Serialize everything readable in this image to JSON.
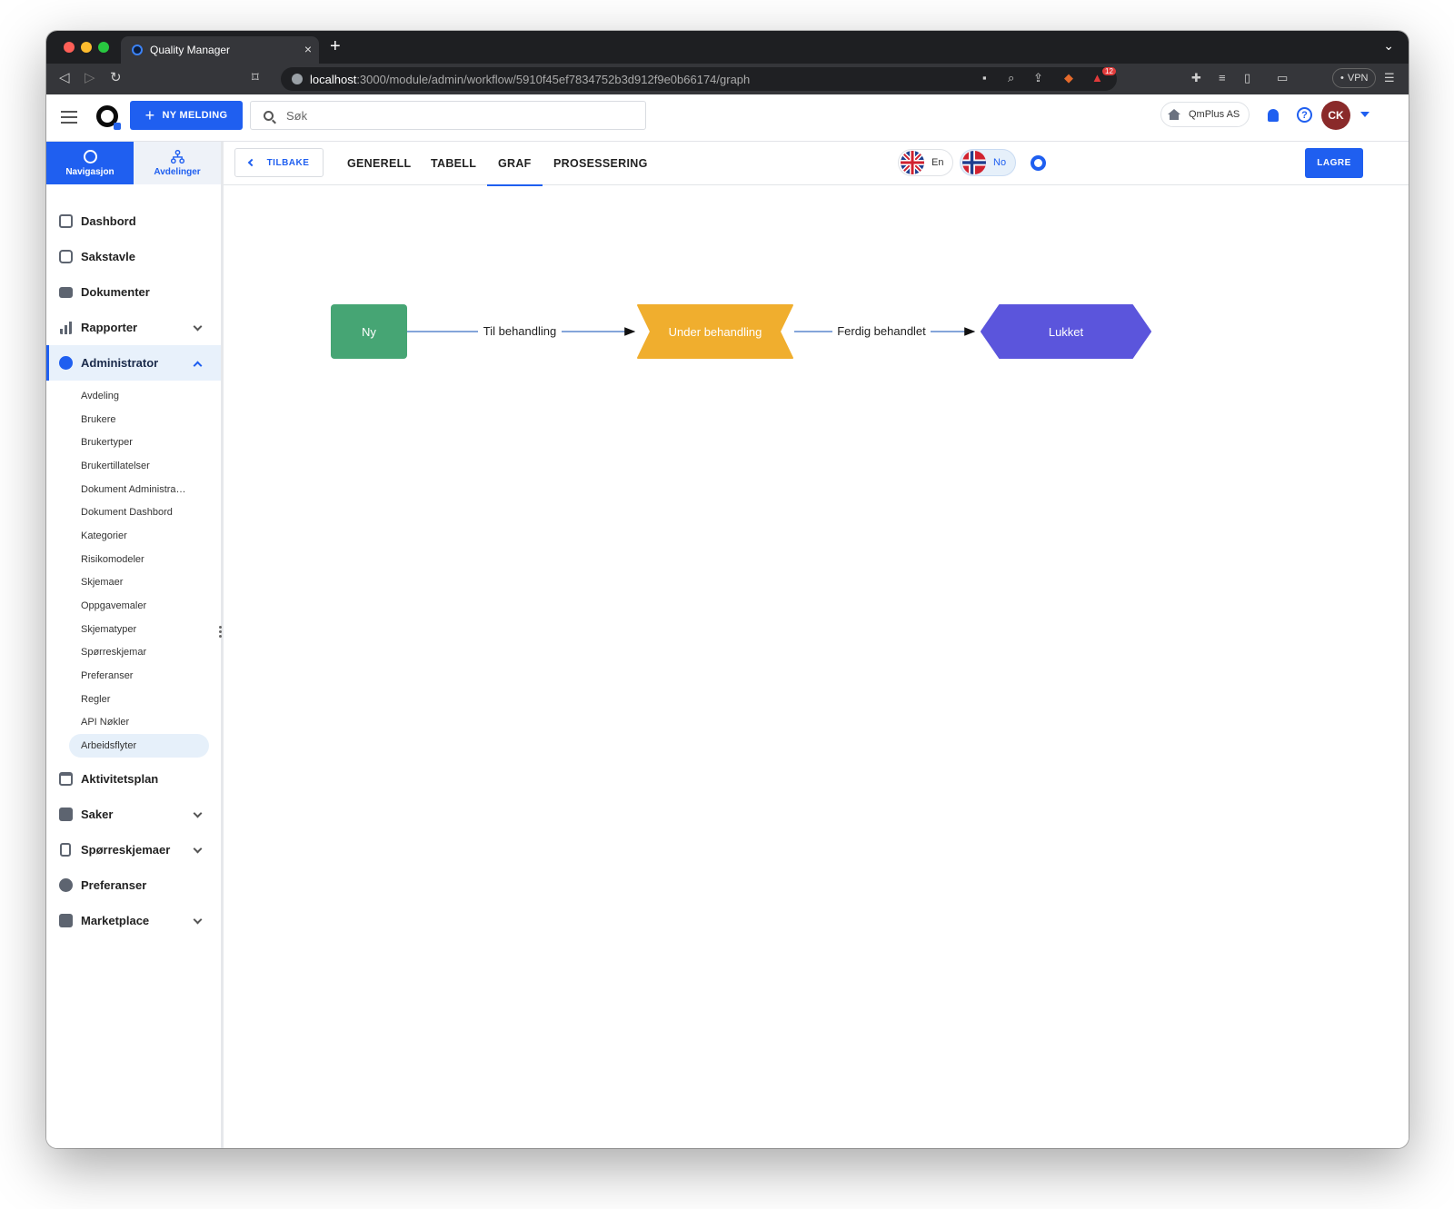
{
  "browser": {
    "tab_title": "Quality Manager",
    "url_host": "localhost",
    "url_rest": ":3000/module/admin/workflow/5910f45ef7834752b3d912f9e0b66174/graph",
    "vpn_label": "VPN",
    "brave_badge": "12"
  },
  "header": {
    "new_message_label": "NY MELDING",
    "search_placeholder": "Søk",
    "company_label": "QmPlus AS",
    "avatar_initials": "CK"
  },
  "sidebar": {
    "tabs": [
      {
        "label": "Navigasjon",
        "icon": "compass-icon",
        "active": true
      },
      {
        "label": "Avdelinger",
        "icon": "org-chart-icon",
        "active": false
      }
    ],
    "items": [
      {
        "label": "Dashbord",
        "icon": "dashboard-icon"
      },
      {
        "label": "Sakstavle",
        "icon": "kanban-icon"
      },
      {
        "label": "Dokumenter",
        "icon": "folder-icon"
      },
      {
        "label": "Rapporter",
        "icon": "bar-chart-icon",
        "expandable": true
      },
      {
        "label": "Administrator",
        "icon": "admin-gear-icon",
        "expandable": true,
        "expanded": true
      }
    ],
    "admin_subitems": [
      "Avdeling",
      "Brukere",
      "Brukertyper",
      "Brukertillatelser",
      "Dokument Administra…",
      "Dokument Dashbord",
      "Kategorier",
      "Risikomodeler",
      "Skjemaer",
      "Oppgavemaler",
      "Skjematyper",
      "Spørreskjemar",
      "Preferanser",
      "Regler",
      "API Nøkler",
      "Arbeidsflyter"
    ],
    "active_subitem": "Arbeidsflyter",
    "items_after": [
      {
        "label": "Aktivitetsplan",
        "icon": "calendar-icon"
      },
      {
        "label": "Saker",
        "icon": "cases-icon",
        "expandable": true
      },
      {
        "label": "Spørreskjemaer",
        "icon": "clipboard-icon",
        "expandable": true
      },
      {
        "label": "Preferanser",
        "icon": "settings-icon"
      },
      {
        "label": "Marketplace",
        "icon": "store-icon",
        "expandable": true
      }
    ]
  },
  "toolbar": {
    "back_label": "TILBAKE",
    "tabs": [
      "GENERELL",
      "TABELL",
      "GRAF",
      "PROSESSERING"
    ],
    "active_tab": "GRAF",
    "languages": [
      {
        "label": "En",
        "flag": "uk-flag-icon",
        "active": false
      },
      {
        "label": "No",
        "flag": "norway-flag-icon",
        "active": true
      }
    ],
    "save_label": "LAGRE"
  },
  "workflow": {
    "nodes": [
      {
        "label": "Ny",
        "color": "#46a574",
        "shape": "rounded-rect"
      },
      {
        "label": "Under behandling",
        "color": "#f0ae2e",
        "shape": "notched-rect"
      },
      {
        "label": "Lukket",
        "color": "#5b55dc",
        "shape": "hexagon"
      }
    ],
    "edges": [
      {
        "label": "Til behandling",
        "from": "Ny",
        "to": "Under behandling"
      },
      {
        "label": "Ferdig behandlet",
        "from": "Under behandling",
        "to": "Lukket"
      }
    ]
  },
  "colors": {
    "primary": "#1f5ff0",
    "admin_highlight": "#e8f1fb",
    "avatar": "#8a2a2a"
  }
}
